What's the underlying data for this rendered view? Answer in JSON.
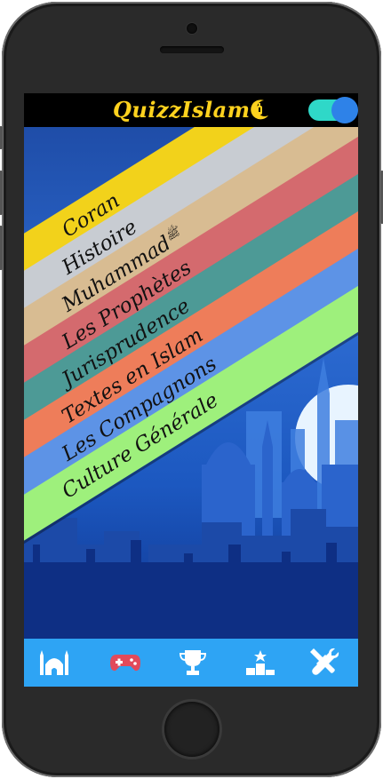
{
  "app": {
    "title": "QuizzIslam"
  },
  "settings": {
    "toggle_on": true
  },
  "categories": [
    {
      "label": "Coran",
      "color": "#f2d21b"
    },
    {
      "label": "Histoire",
      "color": "#c8ccd2"
    },
    {
      "label": "Muhammad",
      "suffix": "ﷺ",
      "color": "#d8bc92"
    },
    {
      "label": "Les Prophètes",
      "color": "#d46a6e"
    },
    {
      "label": "Jurisprudence",
      "color": "#4d9a96"
    },
    {
      "label": "Textes en Islam",
      "color": "#ee7d5a"
    },
    {
      "label": "Les Compagnons",
      "color": "#5d93e6"
    },
    {
      "label": "Culture Générale",
      "color": "#9ef07c"
    }
  ],
  "nav": {
    "items": [
      {
        "name": "home",
        "icon": "mosque-icon"
      },
      {
        "name": "play",
        "icon": "gamepad-icon"
      },
      {
        "name": "trophies",
        "icon": "trophy-icon"
      },
      {
        "name": "ranking",
        "icon": "podium-icon"
      },
      {
        "name": "settings",
        "icon": "tools-icon"
      }
    ]
  },
  "colors": {
    "accent": "#ffd21e",
    "nav_bg": "#2ea4f4",
    "topbar_bg": "#000000",
    "toggle_track": "#2fd8c8",
    "toggle_knob": "#2e82e8"
  }
}
